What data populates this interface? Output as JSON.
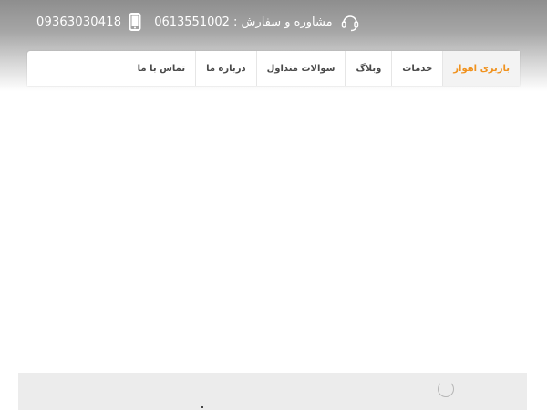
{
  "contact": {
    "mobile_number": "09363030418",
    "advice_label": "مشاوره و سفارش :",
    "advice_number": "0613551002",
    "mobile_icon": "mobile-phone-icon",
    "headset_icon": "headset-icon"
  },
  "nav": {
    "items": [
      {
        "label": "باربری اهواز",
        "active": true
      },
      {
        "label": "خدمات",
        "active": false
      },
      {
        "label": "وبلاگ",
        "active": false
      },
      {
        "label": "سوالات متداول",
        "active": false
      },
      {
        "label": "درباره ما",
        "active": false
      },
      {
        "label": "تماس با ما",
        "active": false
      }
    ]
  },
  "colors": {
    "accent": "#f0921e",
    "nav_text": "#4a4a4a",
    "header_gray": "#8e8e8e"
  }
}
